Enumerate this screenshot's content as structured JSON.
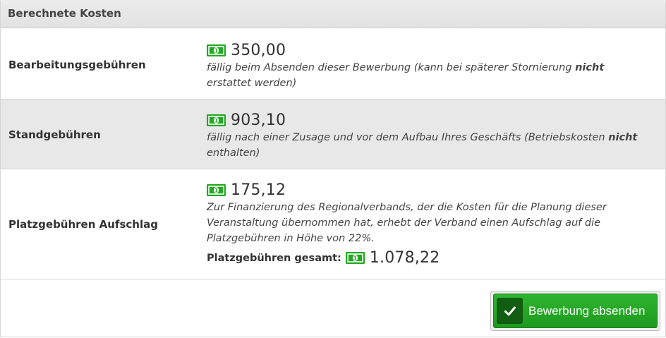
{
  "panel": {
    "title": "Berechnete Kosten"
  },
  "rows": [
    {
      "label": "Bearbeitungsgebühren",
      "amount": "350,00",
      "note_before": "fällig beim Absenden dieser Bewerbung (kann bei späterer Stornierung ",
      "note_bold": "nicht",
      "note_after": " erstattet werden)"
    },
    {
      "label": "Standgebühren",
      "amount": "903,10",
      "note_before": "fällig nach einer Zusage und vor dem Aufbau Ihres Geschäfts (Betriebskosten ",
      "note_bold": "nicht",
      "note_after": " enthalten)"
    },
    {
      "label": "Platzgebühren Aufschlag",
      "amount": "175,12",
      "note": "Zur Finanzierung des Regionalverbands, der die Kosten für die Planung dieser Veranstaltung übernommen hat, erhebt der Verband einen Aufschlag auf die Platzgebühren in Höhe von 22%.",
      "total_label": "Platzgebühren gesamt:",
      "total_amount": "1.078,22"
    }
  ],
  "submit": {
    "label": "Bewerbung absenden"
  },
  "icons": {
    "money": "money-icon",
    "check": "check-icon"
  },
  "colors": {
    "money_green": "#22a822",
    "button_green": "#2fb52f",
    "button_dark": "#115e12",
    "row_alt": "#e8e8e8"
  }
}
